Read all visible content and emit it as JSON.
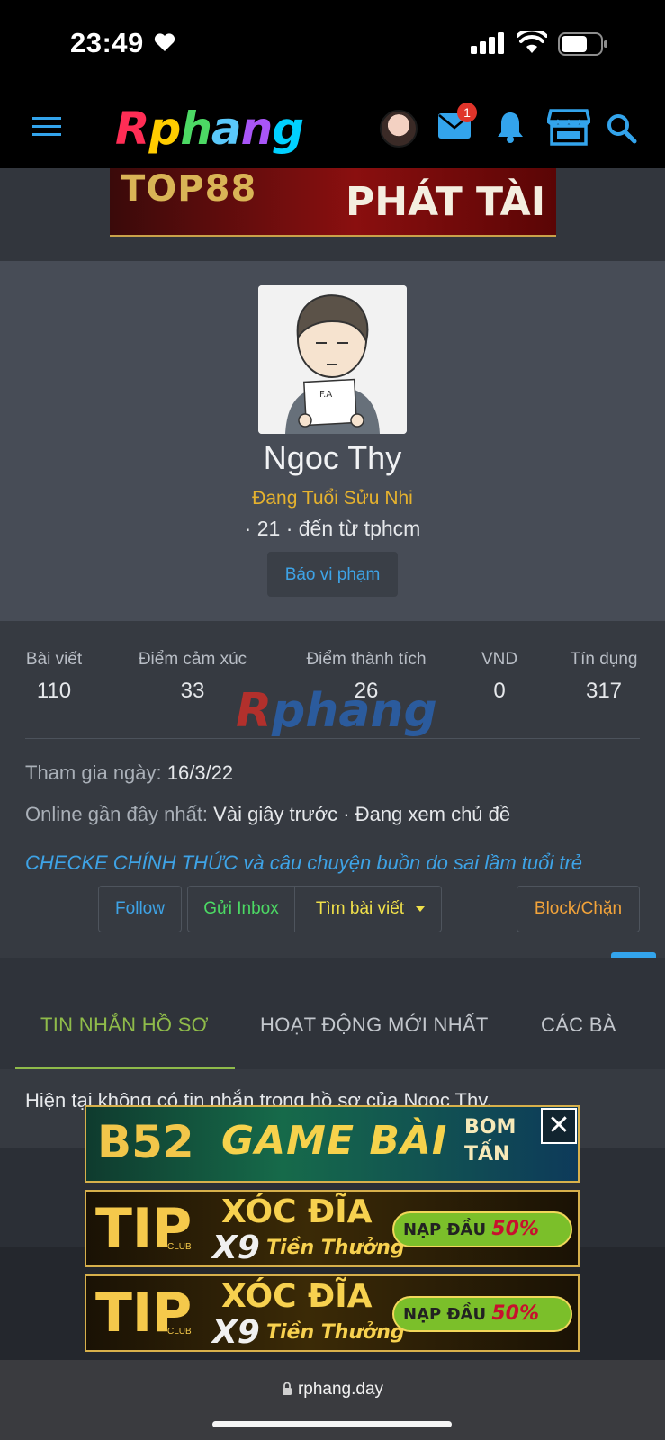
{
  "status_bar": {
    "time": "23:49"
  },
  "nav": {
    "logo_letters": [
      "R",
      "p",
      "h",
      "a",
      "n",
      "g"
    ],
    "mail_badge_count": "1"
  },
  "top_ad": {
    "left_text": "TOP88",
    "right_text": "PHÁT TÀI"
  },
  "profile": {
    "name": "Ngoc Thy",
    "title": "Đang Tuổi Sửu Nhi",
    "meta": "· 21 · đến từ tphcm",
    "report_label": "Báo vi phạm",
    "avatar_sign_text": "F.A"
  },
  "stats": [
    {
      "label": "Bài viết",
      "value": "110"
    },
    {
      "label": "Điểm cảm xúc",
      "value": "33"
    },
    {
      "label": "Điểm thành tích",
      "value": "26"
    },
    {
      "label": "VND",
      "value": "0"
    },
    {
      "label": "Tín dụng",
      "value": "317"
    }
  ],
  "watermark": "Rphang",
  "info": {
    "joined_label": "Tham gia ngày:",
    "joined_value": "16/3/22",
    "online_label": "Online gần đây nhất:",
    "online_value": "Vài giây trước · Đang xem chủ đề",
    "thread_link": "CHECKE CHÍNH THỨC và câu chuyện buồn do sai lầm tuổi trẻ"
  },
  "actions": {
    "follow": "Follow",
    "inbox": "Gửi Inbox",
    "find_posts": "Tìm bài viết",
    "block": "Block/Chặn"
  },
  "tabs": [
    "TIN NHẮN HỒ SƠ",
    "HOẠT ĐỘNG MỚI NHẤT",
    "CÁC BÀ"
  ],
  "content": {
    "text": "Hiện tại không có tin nhắn trong hồ sơ của Ngoc Thy."
  },
  "ads": {
    "b52": {
      "logo": "B52",
      "main": "GAME BÀI",
      "side_1": "BOM",
      "side_2": "TẤN"
    },
    "tip": {
      "logo": "TIP",
      "club": "CLUB",
      "xoc": "XÓC ĐĨA",
      "x9": "X9",
      "sub": "Tiền Thưởng",
      "pill": "NẠP ĐẦU",
      "pill_pct": "50%"
    },
    "close_label": "✕"
  },
  "url_bar": {
    "domain": "rphang.day"
  },
  "colors": {
    "accent_blue": "#3ea3e6",
    "title_gold": "#e6b22e",
    "tab_active_green": "#8fbb4a",
    "inbox_green": "#4cd964",
    "find_yellow": "#f0e04a",
    "block_orange": "#f2a33a"
  }
}
